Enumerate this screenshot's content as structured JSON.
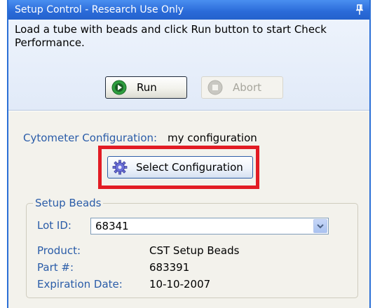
{
  "window": {
    "title": "Setup Control - Research Use Only"
  },
  "instructions": "Load a tube with beads and click Run button to start Check Performance.",
  "actions": {
    "run_label": "Run",
    "abort_label": "Abort"
  },
  "cytometer": {
    "label": "Cytometer Configuration:",
    "value": "my configuration"
  },
  "select_configuration_label": "Select Configuration",
  "setup_beads": {
    "title": "Setup Beads",
    "lot_id_label": "Lot ID:",
    "lot_id_value": "68341",
    "product_label": "Product:",
    "product_value": "CST Setup Beads",
    "part_label": "Part #:",
    "part_value": "683391",
    "expiration_label": "Expiration Date:",
    "expiration_value": "10-10-2007"
  },
  "colors": {
    "title_bar": "#2a6ad8",
    "label_blue": "#2a5ca8",
    "highlight_red": "#e21c24"
  },
  "icons": {
    "pin": "pin-icon",
    "run": "play-icon",
    "abort": "stop-icon",
    "select": "gear-icon",
    "combo": "chevron-down-icon"
  }
}
